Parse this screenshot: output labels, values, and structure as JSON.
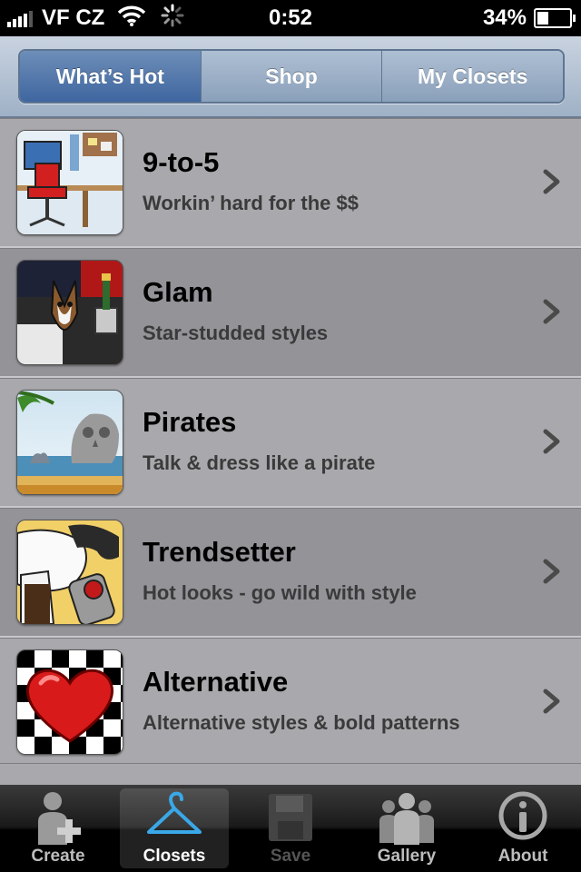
{
  "status_bar": {
    "carrier": "VF CZ",
    "time": "0:52",
    "battery_percent": "34%",
    "battery_level": 0.34
  },
  "segments": [
    {
      "label": "What’s Hot",
      "active": true
    },
    {
      "label": "Shop",
      "active": false
    },
    {
      "label": "My Closets",
      "active": false
    }
  ],
  "items": [
    {
      "title": "9-to-5",
      "subtitle": "Workin’ hard for the $$",
      "icon": "office-chair-icon"
    },
    {
      "title": "Glam",
      "subtitle": "Star-studded styles",
      "icon": "dog-champagne-icon"
    },
    {
      "title": "Pirates",
      "subtitle": "Talk & dress like a pirate",
      "icon": "skull-island-icon"
    },
    {
      "title": "Trendsetter",
      "subtitle": "Hot looks - go wild with style",
      "icon": "wtf-sunglasses-icon"
    },
    {
      "title": "Alternative",
      "subtitle": "Alternative styles & bold patterns",
      "icon": "heart-checkerboard-icon"
    }
  ],
  "tabbar": [
    {
      "label": "Create",
      "icon": "person-plus-icon",
      "state": "normal"
    },
    {
      "label": "Closets",
      "icon": "hanger-icon",
      "state": "active"
    },
    {
      "label": "Save",
      "icon": "floppy-disk-icon",
      "state": "disabled"
    },
    {
      "label": "Gallery",
      "icon": "group-icon",
      "state": "normal"
    },
    {
      "label": "About",
      "icon": "info-icon",
      "state": "normal"
    }
  ],
  "colors": {
    "segment_active": "#3f66a0",
    "hanger_blue": "#3aa8e8"
  }
}
